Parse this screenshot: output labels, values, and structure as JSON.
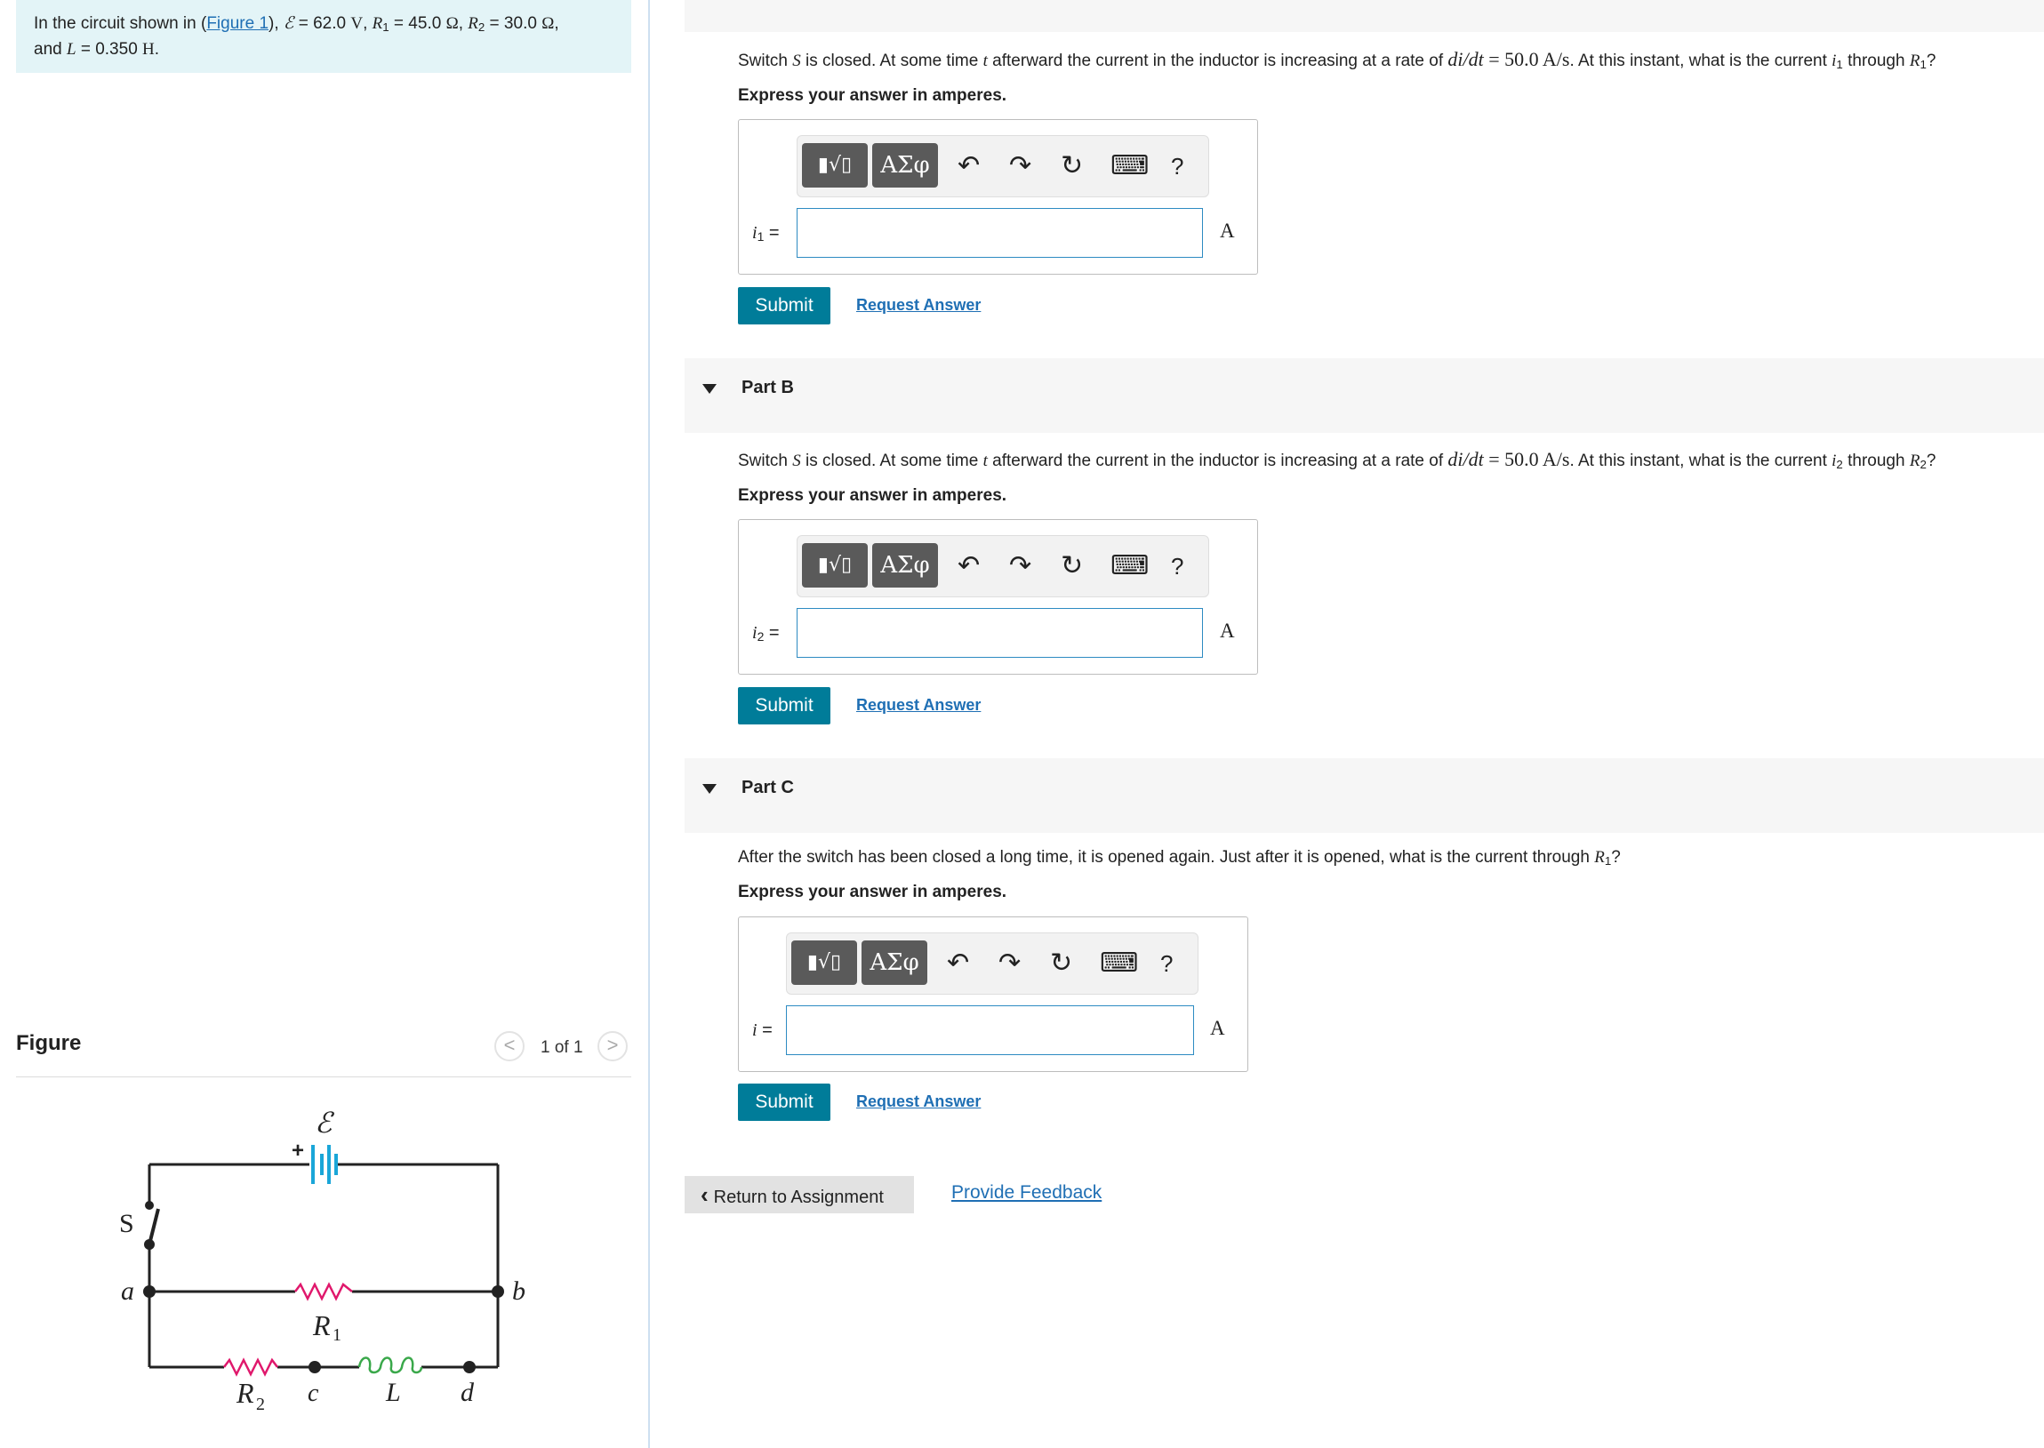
{
  "intro": {
    "prefix": "In the circuit shown in (",
    "figure_link": "Figure 1",
    "after_link": "), ",
    "emf_symbol": "ℰ",
    "emf_value": " = 62.0 ",
    "emf_unit": "V",
    "r1_value": " = 45.0 ",
    "r2_value": " = 30.0 ",
    "ohm": "Ω",
    "and": "and ",
    "l_value": " = 0.350 ",
    "l_unit": "H"
  },
  "figure": {
    "title": "Figure",
    "counter": "1 of 1",
    "prev_icon": "<",
    "next_icon": ">",
    "labels": {
      "emf": "ℰ",
      "switch": "S",
      "a": "a",
      "b": "b",
      "c": "c",
      "d": "d",
      "r1": "R",
      "r1_sub": "1",
      "r2": "R",
      "r2_sub": "2",
      "L": "L",
      "plus": "+"
    }
  },
  "parts": {
    "a": {
      "q_switch": "Switch ",
      "q_mid": " is closed. At some time ",
      "q_after": " afterward the current in the inductor is increasing at a rate of ",
      "q_rate": "di/dt",
      "q_eq": " = 50.0 A/s",
      "q_tail": ". At this instant, what is the current ",
      "q_through": " through ",
      "q_end": "?",
      "express": "Express your answer in amperes.",
      "input_label": "i",
      "input_sub": "1",
      "unit": "A",
      "submit": "Submit",
      "request": "Request Answer"
    },
    "b": {
      "title": "Part B",
      "q_switch": "Switch ",
      "q_mid": " is closed. At some time ",
      "q_after": " afterward the current in the inductor is increasing at a rate of ",
      "q_rate": "di/dt",
      "q_eq": " = 50.0 A/s",
      "q_tail": ". At this instant, what is the current ",
      "q_through": " through ",
      "q_end": "?",
      "express": "Express your answer in amperes.",
      "input_label": "i",
      "input_sub": "2",
      "unit": "A",
      "submit": "Submit",
      "request": "Request Answer"
    },
    "c": {
      "title": "Part C",
      "question": "After the switch has been closed a long time, it is opened again. Just after it is opened, what is the current through ",
      "q_end": "?",
      "express": "Express your answer in amperes.",
      "input_label": "i",
      "unit": "A",
      "submit": "Submit",
      "request": "Request Answer"
    }
  },
  "toolbar": {
    "templates_icon": "▮√▯",
    "greek_label": "ΑΣφ",
    "undo_icon": "↶",
    "redo_icon": "↷",
    "reset_icon": "↻",
    "keyboard_icon": "⌨",
    "help_icon": "?"
  },
  "footer": {
    "return": "Return to Assignment",
    "return_icon": "‹",
    "feedback": "Provide Feedback"
  },
  "colors": {
    "accent": "#007c99",
    "link": "#1f6fb4",
    "intro_bg": "#e3f4f7",
    "resistor": "#e0186c",
    "inductor": "#3aa84a",
    "battery": "#1aa6d8"
  }
}
